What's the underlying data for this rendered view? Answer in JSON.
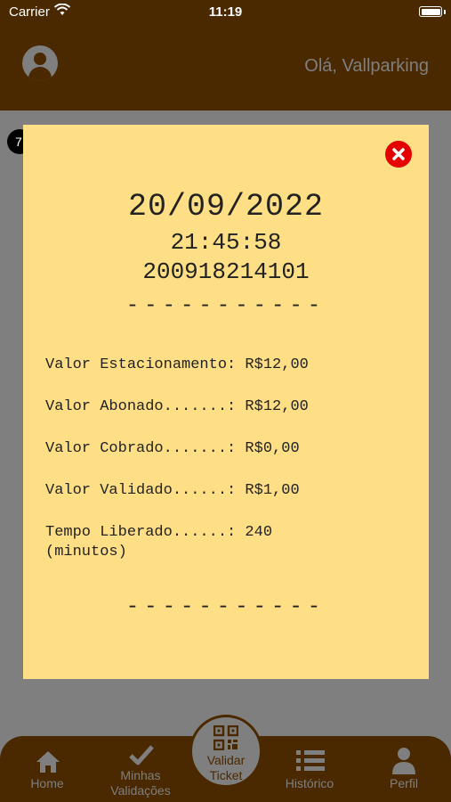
{
  "status_bar": {
    "carrier": "Carrier",
    "time": "11:19"
  },
  "header": {
    "greeting": "Olá, Vallparking",
    "avatar_icon": "user-circle-icon"
  },
  "background": {
    "badge_text": "7"
  },
  "ticket": {
    "date": "20/09/2022",
    "time": "21:45:58",
    "code": "200918214101",
    "separator": "-----------",
    "lines": [
      {
        "label": "Valor Estacionamento: R$12,00"
      },
      {
        "label": "Valor Abonado.......: R$12,00"
      },
      {
        "label": "Valor Cobrado.......: R$0,00"
      },
      {
        "label": "Valor Validado......: R$1,00"
      },
      {
        "label": "Tempo Liberado......: 240 (minutos)"
      }
    ],
    "close_icon": "close-circle-icon"
  },
  "tab_bar": {
    "home": {
      "label": "Home",
      "icon": "home-icon"
    },
    "validations": {
      "label": "Minhas\nValidações",
      "icon": "checkmark-icon"
    },
    "validate_ticket": {
      "label": "Validar\nTicket",
      "icon": "qr-code-icon"
    },
    "history": {
      "label": "Histórico",
      "icon": "list-icon"
    },
    "profile": {
      "label": "Perfil",
      "icon": "person-icon"
    }
  },
  "colors": {
    "brand_dark": "#4a2800",
    "ticket_bg": "#ffdf85",
    "overlay_gray": "#7f7f7f",
    "close_red": "#e50000"
  }
}
